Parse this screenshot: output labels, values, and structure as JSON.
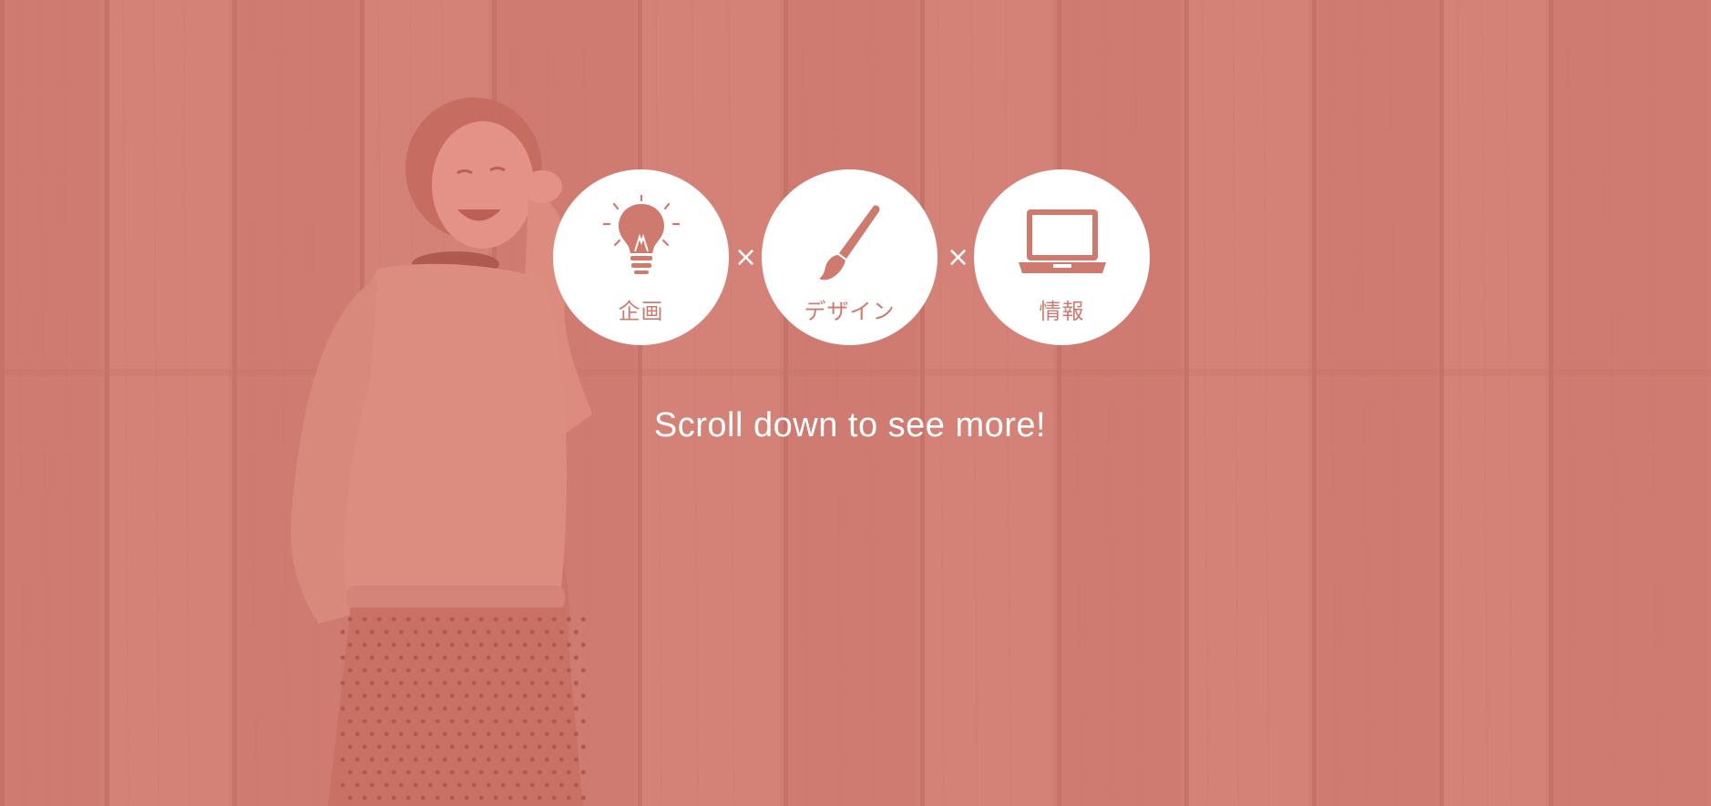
{
  "hero": {
    "background_color": "#d08076",
    "services": [
      {
        "label": "企画",
        "icon": "lightbulb-icon"
      },
      {
        "label": "デザイン",
        "icon": "paintbrush-icon"
      },
      {
        "label": "情報",
        "icon": "laptop-icon"
      }
    ],
    "separator": "×",
    "scroll_prompt": "Scroll down to see more!"
  }
}
